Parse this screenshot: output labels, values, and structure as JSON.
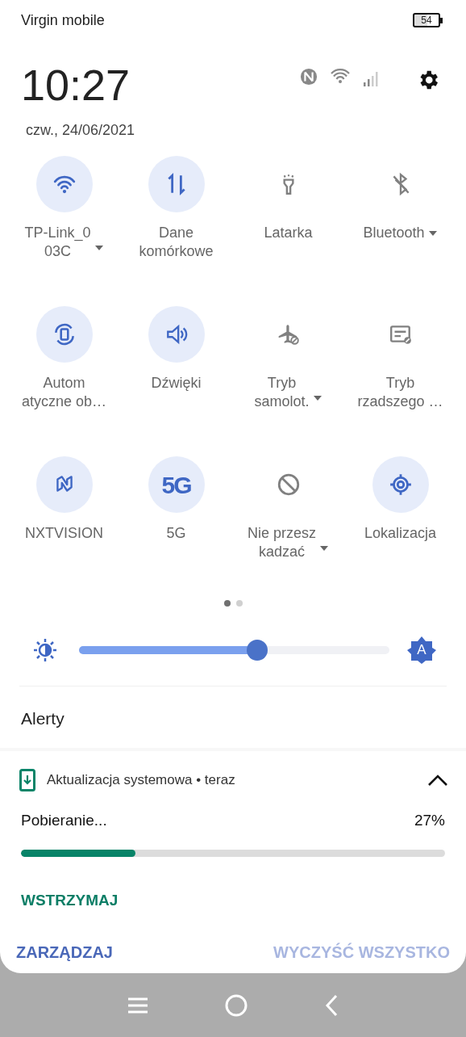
{
  "status_bar": {
    "carrier": "Virgin mobile",
    "battery": "54"
  },
  "header": {
    "time": "10:27",
    "date": "czw., 24/06/2021"
  },
  "tiles": [
    {
      "label": [
        "TP-Link_0",
        "03C"
      ],
      "on": true,
      "dropdown": true
    },
    {
      "label": [
        "Dane",
        "komórkowe"
      ],
      "on": true,
      "dropdown": false
    },
    {
      "label": [
        "Latarka"
      ],
      "on": false,
      "dropdown": false
    },
    {
      "label": [
        "Bluetooth"
      ],
      "on": false,
      "dropdown": true
    },
    {
      "label": [
        "Autom",
        "atyczne ob…"
      ],
      "on": true,
      "dropdown": false
    },
    {
      "label": [
        "Dźwięki"
      ],
      "on": true,
      "dropdown": false
    },
    {
      "label": [
        "Tryb",
        "samolot."
      ],
      "on": false,
      "dropdown": true
    },
    {
      "label": [
        "Tryb",
        "rzadszego …"
      ],
      "on": false,
      "dropdown": false
    },
    {
      "label": [
        "NXTVISION"
      ],
      "on": true,
      "dropdown": false
    },
    {
      "icon_text": "5G",
      "label": [
        "5G"
      ],
      "on": true,
      "dropdown": false
    },
    {
      "label": [
        "Nie przesz",
        "kadzać"
      ],
      "on": false,
      "dropdown": true
    },
    {
      "label": [
        "Lokalizacja"
      ],
      "on": true,
      "dropdown": false
    }
  ],
  "pages": [
    {
      "selected": true
    },
    {
      "selected": false
    }
  ],
  "brightness": {
    "level": 0.575,
    "auto_label": "A"
  },
  "section_title": "Alerty",
  "notification": {
    "app": "Aktualizacja systemowa",
    "separator": "•",
    "time": "teraz",
    "expanded": true,
    "title": "Pobieranie...",
    "percent": "27%",
    "level": 0.27,
    "action": "WSTRZYMAJ"
  },
  "footer": {
    "manage": "ZARZĄDZAJ",
    "clear": "WYCZYŚĆ WSZYSTKO",
    "clear_disabled": true
  }
}
